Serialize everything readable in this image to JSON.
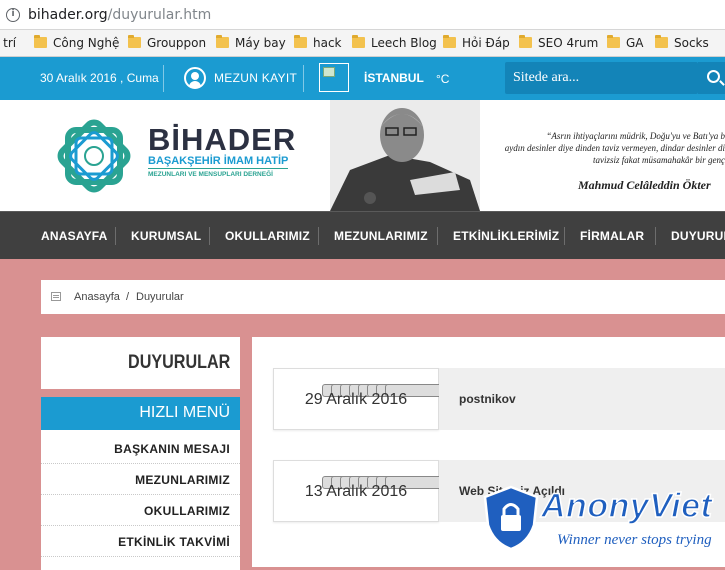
{
  "browser": {
    "url_host": "bihader.org",
    "url_path": "/duyurular.htm",
    "bookmarks": [
      "i trí",
      "Công Nghệ",
      "Grouppon",
      "Máy bay",
      "hack",
      "Leech Blog",
      "Hỏi Đáp",
      "SEO 4rum",
      "GA",
      "Socks"
    ]
  },
  "topbar": {
    "date": "30 Aralık 2016 , Cuma",
    "register": "MEZUN KAYIT",
    "city": "İSTANBUL",
    "degree": "°C",
    "search_placeholder": "Sitede ara..."
  },
  "header": {
    "brand": "BİHADER",
    "sub1": "BAŞAKŞEHİR İMAM HATİP",
    "sub2": "MEZUNLARI VE MENSUPLARI DERNEĞİ",
    "quote": [
      "“Asrın ihtiyaçlarını müdrik, Doğu'yu ve Batı'ya b",
      "aydın desinler diye dinden taviz vermeyen, dindar desinler di",
      "tavizsiz fakat müsamahakâr bir genç"
    ],
    "quote_author": "Mahmud Celâleddin Ökter"
  },
  "nav": [
    "ANASAYFA",
    "KURUMSAL",
    "OKULLARIMIZ",
    "MEZUNLARIMIZ",
    "ETKİNLİKLERİMİZ",
    "FİRMALAR",
    "DUYURUL"
  ],
  "breadcrumb": {
    "home": "Anasayfa",
    "separator": "/",
    "current": "Duyurular"
  },
  "sidebar": {
    "title": "DUYURULAR",
    "quick_menu": "HIZLI MENÜ",
    "items": [
      "BAŞKANIN MESAJI",
      "MEZUNLARIMIZ",
      "OKULLARIMIZ",
      "ETKİNLİK TAKVİMİ"
    ]
  },
  "news": [
    {
      "date": "29 Aralık 2016",
      "title": "postnikov"
    },
    {
      "date": "13 Aralık 2016",
      "title": "Web Sitemiz Açıldı"
    }
  ],
  "watermark": {
    "title": "AnonyViet",
    "subtitle": "Winner never stops trying"
  },
  "colors": {
    "accent": "#1b9bd1",
    "nav_bg": "#404040",
    "page_bg": "#d99191",
    "logo_teal": "#2aa392"
  }
}
